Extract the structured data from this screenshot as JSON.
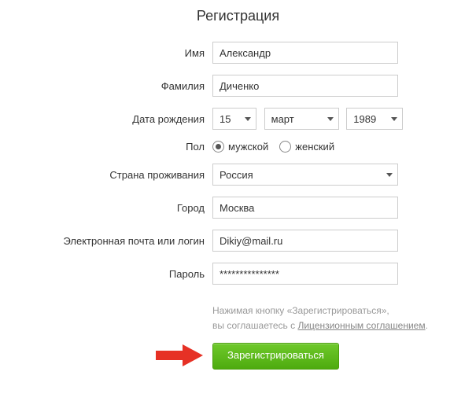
{
  "title": "Регистрация",
  "labels": {
    "name": "Имя",
    "surname": "Фамилия",
    "birthdate": "Дата рождения",
    "gender": "Пол",
    "country": "Страна проживания",
    "city": "Город",
    "email": "Электронная почта или логин",
    "password": "Пароль"
  },
  "values": {
    "name": "Александр",
    "surname": "Диченко",
    "birth_day": "15",
    "birth_month": "март",
    "birth_year": "1989",
    "gender_male": "мужской",
    "gender_female": "женский",
    "country": "Россия",
    "city": "Москва",
    "email": "Dikiy@mail.ru",
    "password_mask": "***************"
  },
  "agreement": {
    "line1": "Нажимая кнопку «Зарегистрироваться»,",
    "line2_prefix": "вы соглашаетесь с ",
    "link": "Лицензионным соглашением"
  },
  "submit_label": "Зарегистрироваться"
}
